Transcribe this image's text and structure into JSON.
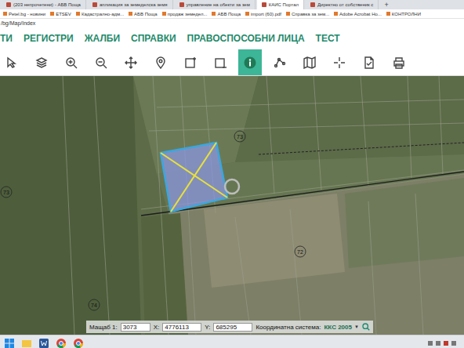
{
  "browser": {
    "tabs": [
      {
        "label": "(203 непрочетени) - АБВ Поща",
        "selected": false
      },
      {
        "label": "апликация за земеделска земя",
        "selected": false
      },
      {
        "label": "управление на обекти за зем",
        "selected": false
      },
      {
        "label": "КАИС Портал",
        "selected": true
      },
      {
        "label": "Директно от собственик с",
        "selected": false
      }
    ],
    "new_tab": "+",
    "bookmarks": [
      "Petel.bg - новини",
      "ETSEV",
      "Кадастрално-адм...",
      "АБВ Поща",
      "продаж земедел...",
      "АБВ Поща",
      "import (60).pdf",
      "Справка за зем...",
      "Adobe Acrobat Ho...",
      "КОНТРОЛНИ"
    ],
    "address": "/bg/Map/Index"
  },
  "app": {
    "menu": [
      "ТИ",
      "РЕГИСТРИ",
      "ЖАЛБИ",
      "СПРАВКИ",
      "ПРАВОСПОСОБНИ ЛИЦА",
      "ТЕСТ"
    ],
    "tools": [
      {
        "kind": "cursor",
        "selected": false
      },
      {
        "kind": "layers",
        "selected": false
      },
      {
        "kind": "zoom-in",
        "selected": false
      },
      {
        "kind": "zoom-out",
        "selected": false
      },
      {
        "kind": "pan",
        "selected": false
      },
      {
        "kind": "pin",
        "selected": false
      },
      {
        "kind": "rect",
        "selected": false
      },
      {
        "kind": "rect-minus",
        "selected": false
      },
      {
        "kind": "info",
        "selected": true
      },
      {
        "kind": "vertex",
        "selected": false
      },
      {
        "kind": "map",
        "selected": false
      },
      {
        "kind": "crosshair",
        "selected": false
      },
      {
        "kind": "document",
        "selected": false
      },
      {
        "kind": "print",
        "selected": false
      }
    ]
  },
  "map": {
    "labels": [
      "73",
      "73",
      "72",
      "74"
    ],
    "selected_parcel": {
      "highlighted": true
    }
  },
  "status_bar": {
    "scale_label": "Мащаб 1:",
    "scale": "3073",
    "x_label": "X:",
    "x": "4776113",
    "y_label": "Y:",
    "y": "685295",
    "crs_label": "Координатна система:",
    "crs": "ККС 2005",
    "dropdown": "▼"
  }
}
